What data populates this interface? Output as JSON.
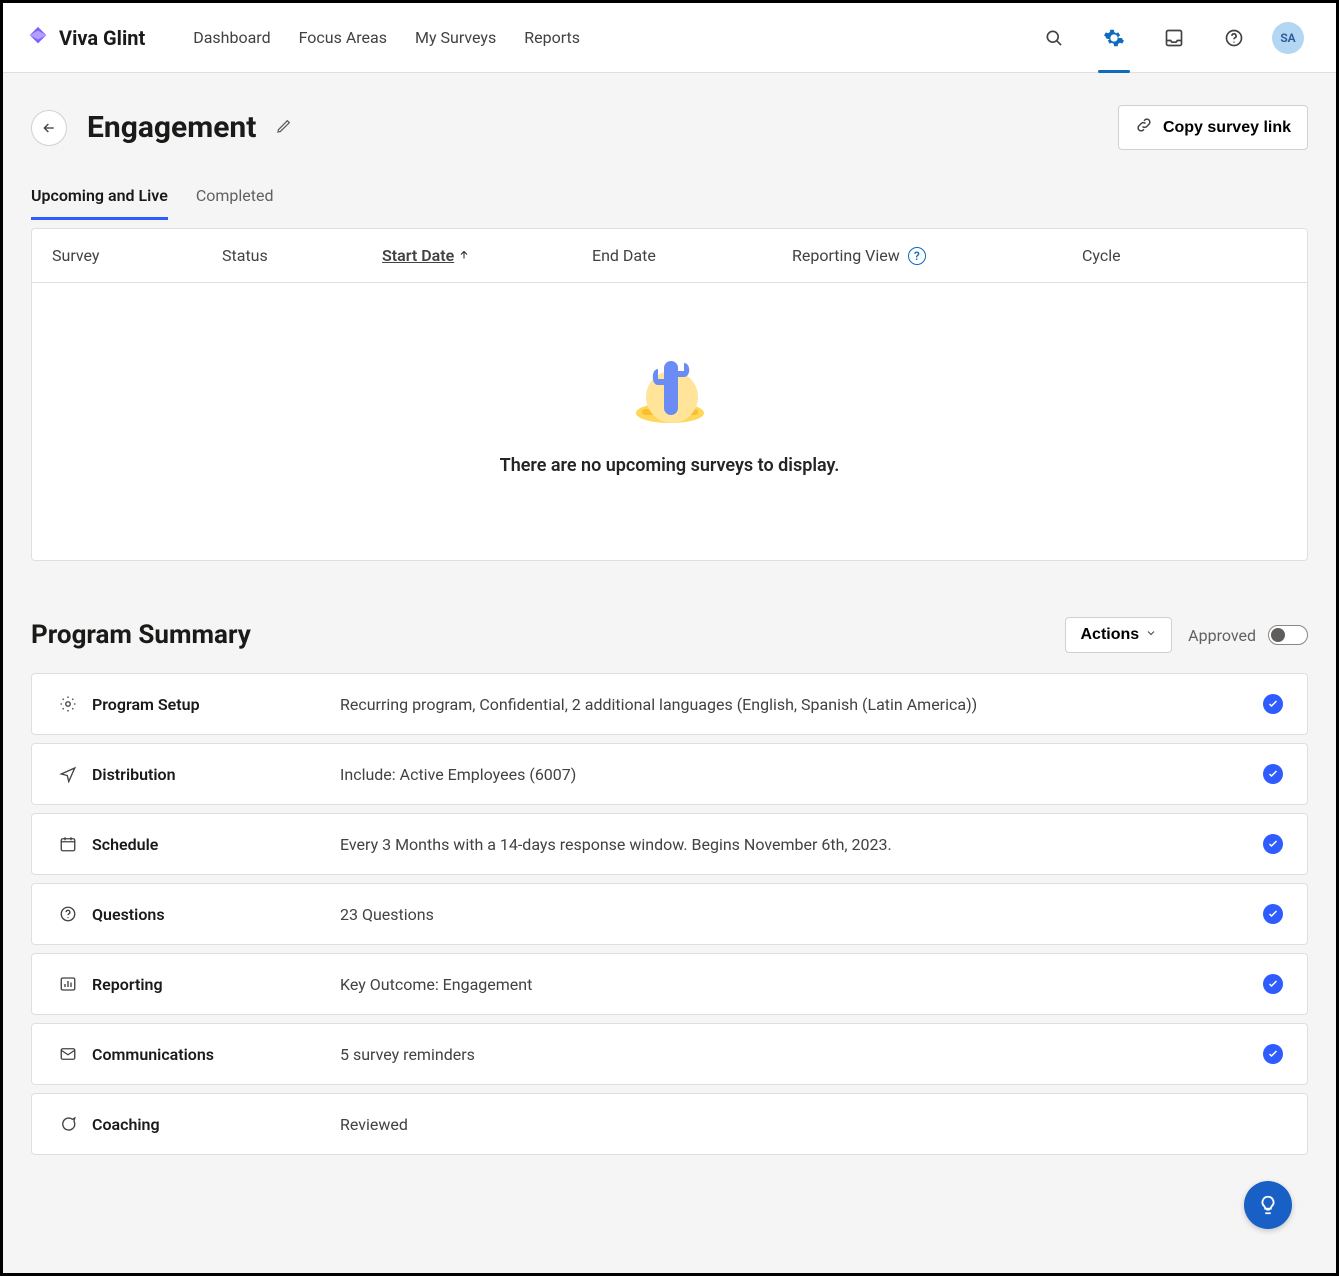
{
  "brand": "Viva Glint",
  "nav": {
    "dashboard": "Dashboard",
    "focus": "Focus Areas",
    "surveys": "My Surveys",
    "reports": "Reports"
  },
  "avatar": "SA",
  "header": {
    "title": "Engagement",
    "copy": "Copy survey link"
  },
  "tabs": {
    "upcoming": "Upcoming and Live",
    "completed": "Completed"
  },
  "table": {
    "cols": {
      "survey": "Survey",
      "status": "Status",
      "start": "Start Date",
      "end": "End Date",
      "report": "Reporting View",
      "cycle": "Cycle"
    },
    "empty": "There are no upcoming surveys to display."
  },
  "summary": {
    "title": "Program Summary",
    "actions": "Actions",
    "approved": "Approved",
    "rows": {
      "setup": {
        "title": "Program Setup",
        "desc": "Recurring program, Confidential, 2 additional languages (English, Spanish (Latin America))"
      },
      "dist": {
        "title": "Distribution",
        "desc": "Include: Active Employees (6007)"
      },
      "sched": {
        "title": "Schedule",
        "desc": "Every 3 Months with a 14-days response window. Begins November 6th, 2023."
      },
      "quest": {
        "title": "Questions",
        "desc": "23 Questions"
      },
      "report": {
        "title": "Reporting",
        "desc": "Key Outcome: Engagement"
      },
      "comm": {
        "title": "Communications",
        "desc": "5 survey reminders"
      },
      "coach": {
        "title": "Coaching",
        "desc": "Reviewed"
      }
    }
  }
}
